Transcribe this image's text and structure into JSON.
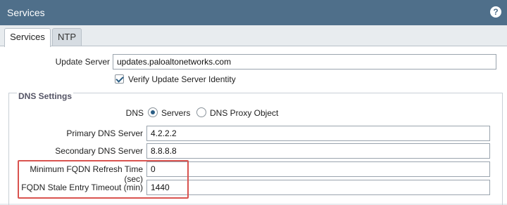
{
  "window": {
    "title": "Services",
    "help_icon": "help-circle-icon",
    "help_glyph": "?"
  },
  "tabs": [
    {
      "label": "Services",
      "active": true
    },
    {
      "label": "NTP",
      "active": false
    }
  ],
  "update_server": {
    "label": "Update Server",
    "value": "updates.paloaltonetworks.com",
    "verify_label": "Verify Update Server Identity",
    "verify_checked": true
  },
  "dns": {
    "legend": "DNS Settings",
    "mode_label": "DNS",
    "options": [
      {
        "label": "Servers",
        "selected": true
      },
      {
        "label": "DNS Proxy Object",
        "selected": false
      }
    ],
    "primary_label": "Primary DNS Server",
    "primary_value": "4.2.2.2",
    "secondary_label": "Secondary DNS Server",
    "secondary_value": "8.8.8.8",
    "fqdn_refresh_label": "Minimum FQDN Refresh Time (sec)",
    "fqdn_refresh_value": "0",
    "fqdn_stale_label": "FQDN Stale Entry Timeout (min)",
    "fqdn_stale_value": "1440"
  },
  "colors": {
    "header": "#4f6f8a",
    "accent": "#2a5d84",
    "highlight": "#d9534f"
  }
}
